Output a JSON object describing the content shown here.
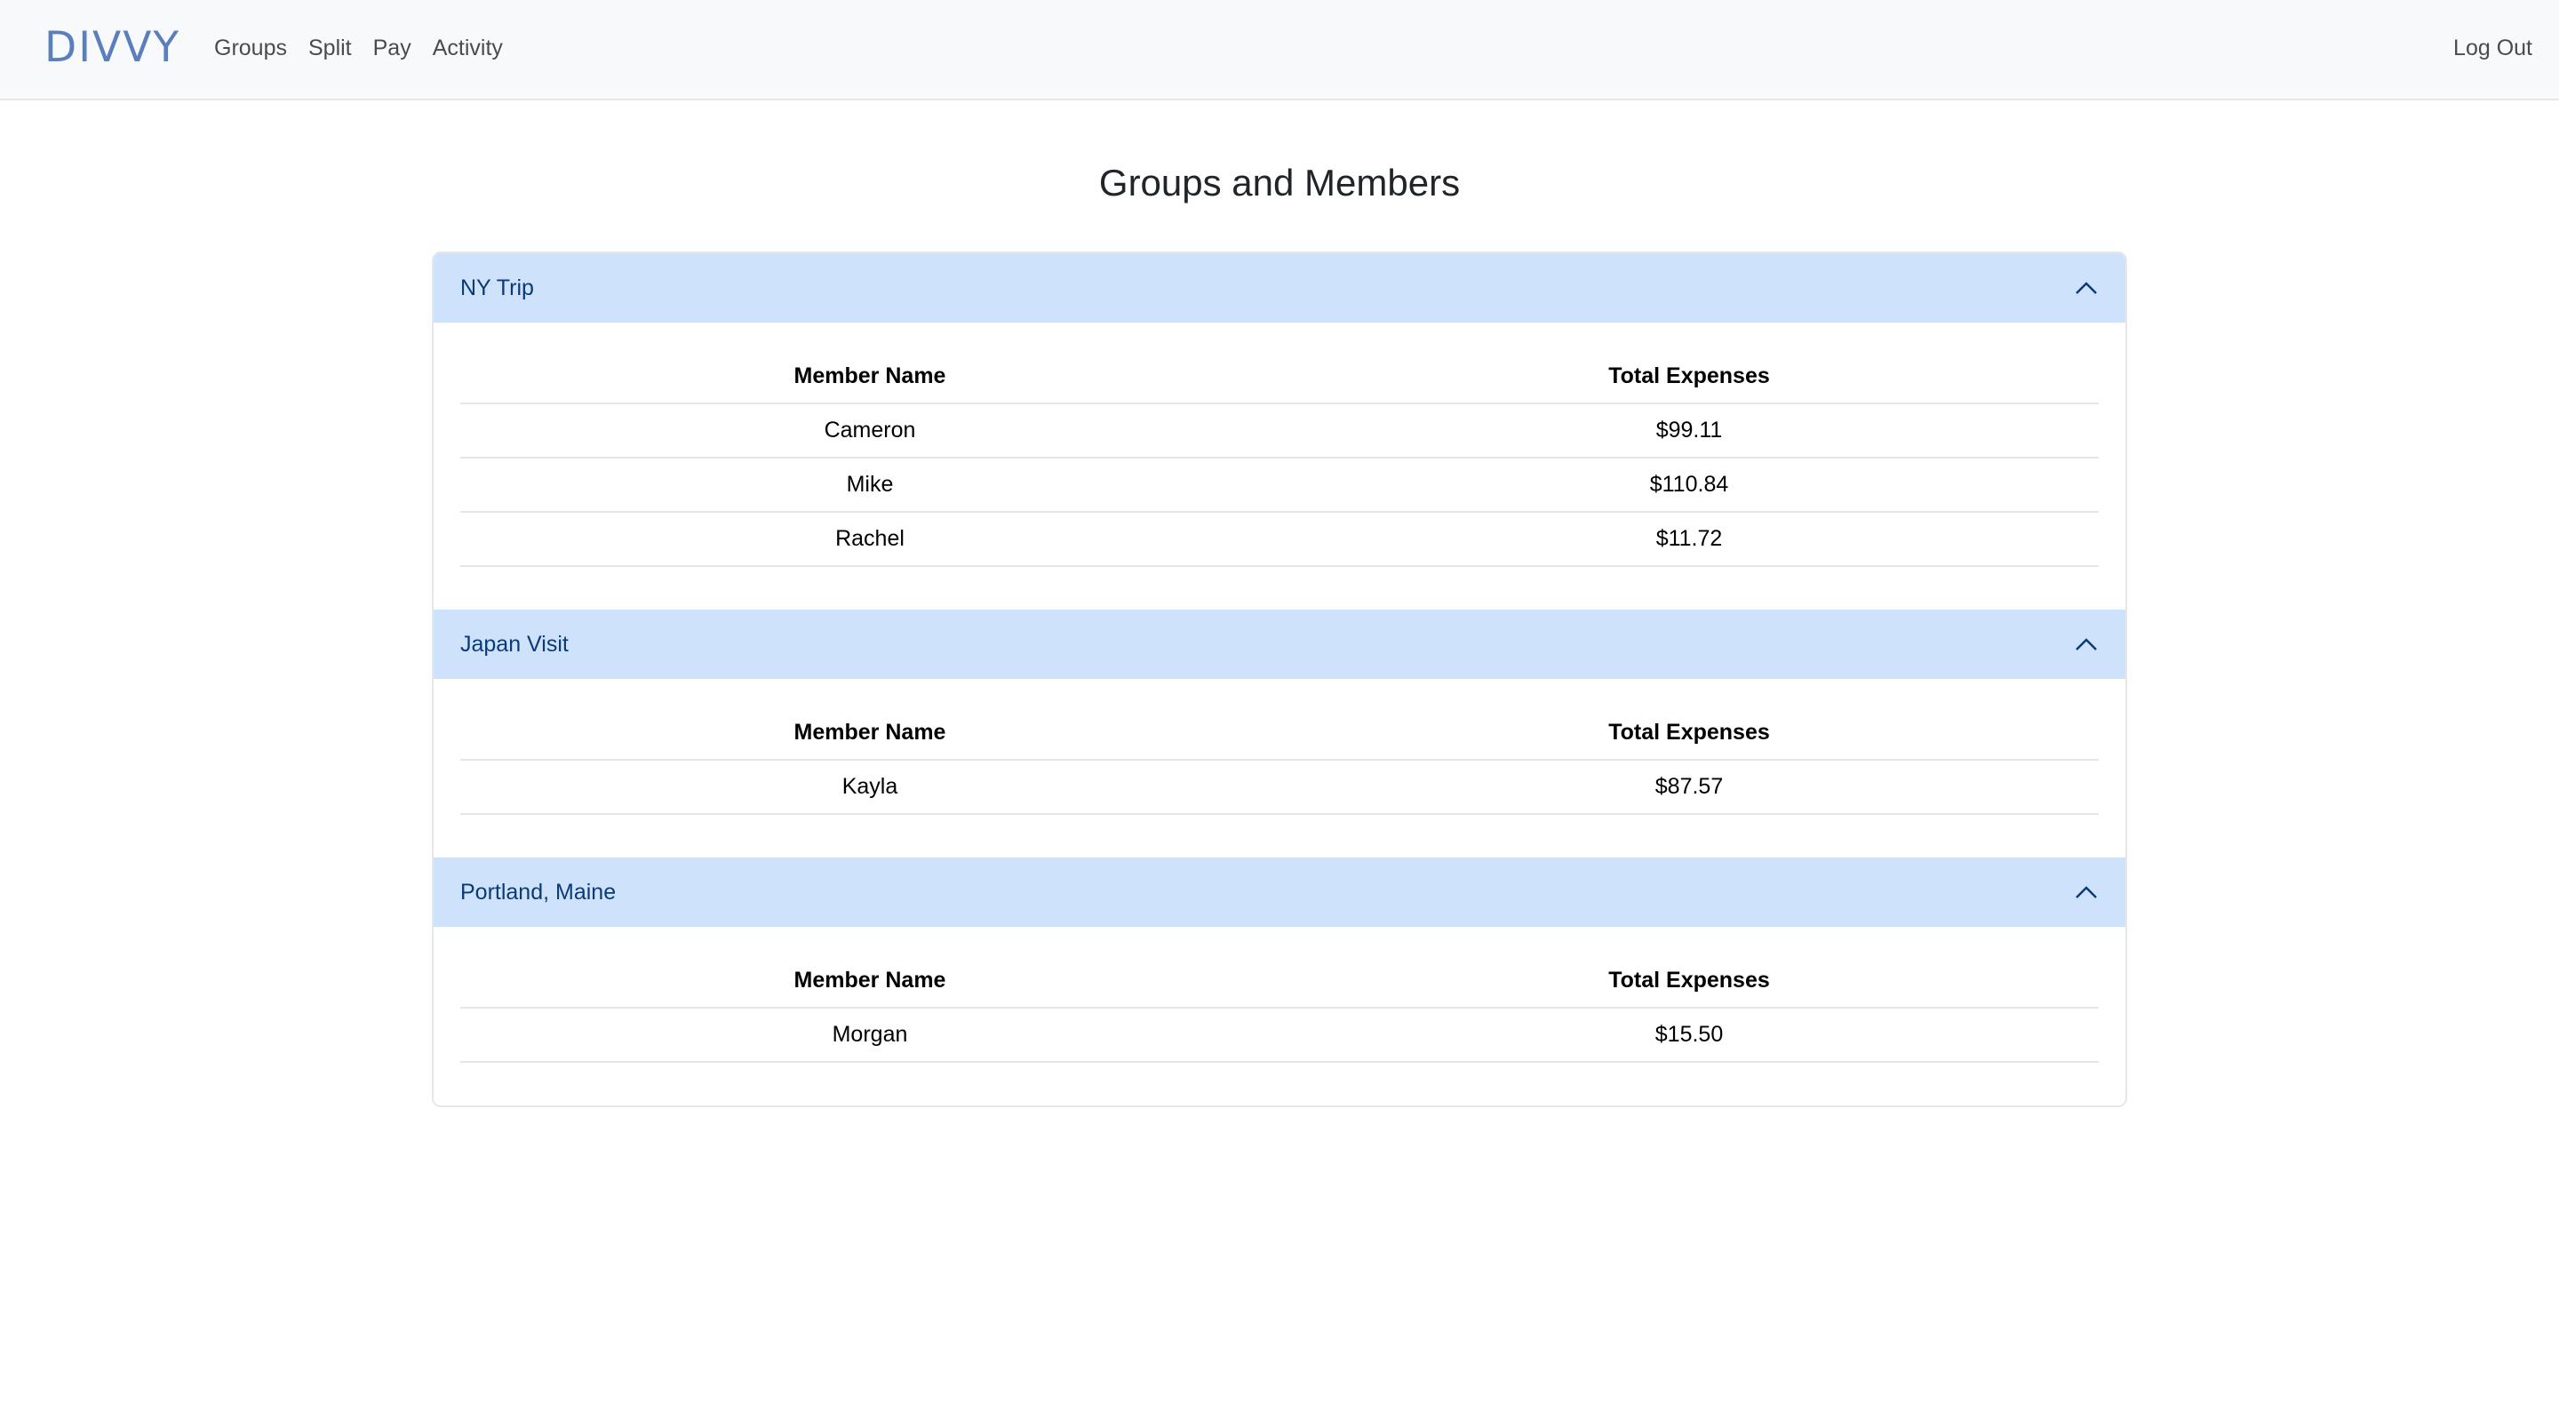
{
  "nav": {
    "brand": "DIVVY",
    "links": [
      "Groups",
      "Split",
      "Pay",
      "Activity"
    ],
    "logout": "Log Out"
  },
  "page": {
    "title": "Groups and Members"
  },
  "groups": [
    {
      "name": "NY Trip",
      "col_member": "Member Name",
      "col_expenses": "Total Expenses",
      "members": [
        {
          "name": "Cameron",
          "total": "$99.11"
        },
        {
          "name": "Mike",
          "total": "$110.84"
        },
        {
          "name": "Rachel",
          "total": "$11.72"
        }
      ]
    },
    {
      "name": "Japan Visit",
      "col_member": "Member Name",
      "col_expenses": "Total Expenses",
      "members": [
        {
          "name": "Kayla",
          "total": "$87.57"
        }
      ]
    },
    {
      "name": "Portland, Maine",
      "col_member": "Member Name",
      "col_expenses": "Total Expenses",
      "members": [
        {
          "name": "Morgan",
          "total": "$15.50"
        }
      ]
    }
  ],
  "icons": {
    "collapse": "chevron-up-icon"
  },
  "colors": {
    "brand": "#5b7fbd",
    "accordion_header_bg": "#cfe2fc",
    "accordion_header_text": "#0b3a78"
  }
}
